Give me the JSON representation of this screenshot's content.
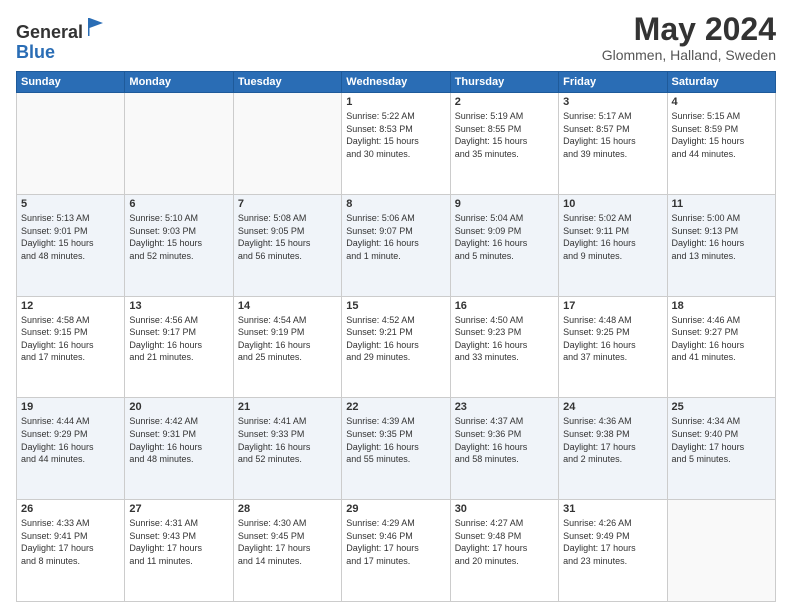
{
  "header": {
    "logo_general": "General",
    "logo_blue": "Blue",
    "month": "May 2024",
    "location": "Glommen, Halland, Sweden"
  },
  "weekdays": [
    "Sunday",
    "Monday",
    "Tuesday",
    "Wednesday",
    "Thursday",
    "Friday",
    "Saturday"
  ],
  "weeks": [
    [
      {
        "day": "",
        "info": ""
      },
      {
        "day": "",
        "info": ""
      },
      {
        "day": "",
        "info": ""
      },
      {
        "day": "1",
        "info": "Sunrise: 5:22 AM\nSunset: 8:53 PM\nDaylight: 15 hours\nand 30 minutes."
      },
      {
        "day": "2",
        "info": "Sunrise: 5:19 AM\nSunset: 8:55 PM\nDaylight: 15 hours\nand 35 minutes."
      },
      {
        "day": "3",
        "info": "Sunrise: 5:17 AM\nSunset: 8:57 PM\nDaylight: 15 hours\nand 39 minutes."
      },
      {
        "day": "4",
        "info": "Sunrise: 5:15 AM\nSunset: 8:59 PM\nDaylight: 15 hours\nand 44 minutes."
      }
    ],
    [
      {
        "day": "5",
        "info": "Sunrise: 5:13 AM\nSunset: 9:01 PM\nDaylight: 15 hours\nand 48 minutes."
      },
      {
        "day": "6",
        "info": "Sunrise: 5:10 AM\nSunset: 9:03 PM\nDaylight: 15 hours\nand 52 minutes."
      },
      {
        "day": "7",
        "info": "Sunrise: 5:08 AM\nSunset: 9:05 PM\nDaylight: 15 hours\nand 56 minutes."
      },
      {
        "day": "8",
        "info": "Sunrise: 5:06 AM\nSunset: 9:07 PM\nDaylight: 16 hours\nand 1 minute."
      },
      {
        "day": "9",
        "info": "Sunrise: 5:04 AM\nSunset: 9:09 PM\nDaylight: 16 hours\nand 5 minutes."
      },
      {
        "day": "10",
        "info": "Sunrise: 5:02 AM\nSunset: 9:11 PM\nDaylight: 16 hours\nand 9 minutes."
      },
      {
        "day": "11",
        "info": "Sunrise: 5:00 AM\nSunset: 9:13 PM\nDaylight: 16 hours\nand 13 minutes."
      }
    ],
    [
      {
        "day": "12",
        "info": "Sunrise: 4:58 AM\nSunset: 9:15 PM\nDaylight: 16 hours\nand 17 minutes."
      },
      {
        "day": "13",
        "info": "Sunrise: 4:56 AM\nSunset: 9:17 PM\nDaylight: 16 hours\nand 21 minutes."
      },
      {
        "day": "14",
        "info": "Sunrise: 4:54 AM\nSunset: 9:19 PM\nDaylight: 16 hours\nand 25 minutes."
      },
      {
        "day": "15",
        "info": "Sunrise: 4:52 AM\nSunset: 9:21 PM\nDaylight: 16 hours\nand 29 minutes."
      },
      {
        "day": "16",
        "info": "Sunrise: 4:50 AM\nSunset: 9:23 PM\nDaylight: 16 hours\nand 33 minutes."
      },
      {
        "day": "17",
        "info": "Sunrise: 4:48 AM\nSunset: 9:25 PM\nDaylight: 16 hours\nand 37 minutes."
      },
      {
        "day": "18",
        "info": "Sunrise: 4:46 AM\nSunset: 9:27 PM\nDaylight: 16 hours\nand 41 minutes."
      }
    ],
    [
      {
        "day": "19",
        "info": "Sunrise: 4:44 AM\nSunset: 9:29 PM\nDaylight: 16 hours\nand 44 minutes."
      },
      {
        "day": "20",
        "info": "Sunrise: 4:42 AM\nSunset: 9:31 PM\nDaylight: 16 hours\nand 48 minutes."
      },
      {
        "day": "21",
        "info": "Sunrise: 4:41 AM\nSunset: 9:33 PM\nDaylight: 16 hours\nand 52 minutes."
      },
      {
        "day": "22",
        "info": "Sunrise: 4:39 AM\nSunset: 9:35 PM\nDaylight: 16 hours\nand 55 minutes."
      },
      {
        "day": "23",
        "info": "Sunrise: 4:37 AM\nSunset: 9:36 PM\nDaylight: 16 hours\nand 58 minutes."
      },
      {
        "day": "24",
        "info": "Sunrise: 4:36 AM\nSunset: 9:38 PM\nDaylight: 17 hours\nand 2 minutes."
      },
      {
        "day": "25",
        "info": "Sunrise: 4:34 AM\nSunset: 9:40 PM\nDaylight: 17 hours\nand 5 minutes."
      }
    ],
    [
      {
        "day": "26",
        "info": "Sunrise: 4:33 AM\nSunset: 9:41 PM\nDaylight: 17 hours\nand 8 minutes."
      },
      {
        "day": "27",
        "info": "Sunrise: 4:31 AM\nSunset: 9:43 PM\nDaylight: 17 hours\nand 11 minutes."
      },
      {
        "day": "28",
        "info": "Sunrise: 4:30 AM\nSunset: 9:45 PM\nDaylight: 17 hours\nand 14 minutes."
      },
      {
        "day": "29",
        "info": "Sunrise: 4:29 AM\nSunset: 9:46 PM\nDaylight: 17 hours\nand 17 minutes."
      },
      {
        "day": "30",
        "info": "Sunrise: 4:27 AM\nSunset: 9:48 PM\nDaylight: 17 hours\nand 20 minutes."
      },
      {
        "day": "31",
        "info": "Sunrise: 4:26 AM\nSunset: 9:49 PM\nDaylight: 17 hours\nand 23 minutes."
      },
      {
        "day": "",
        "info": ""
      }
    ]
  ]
}
